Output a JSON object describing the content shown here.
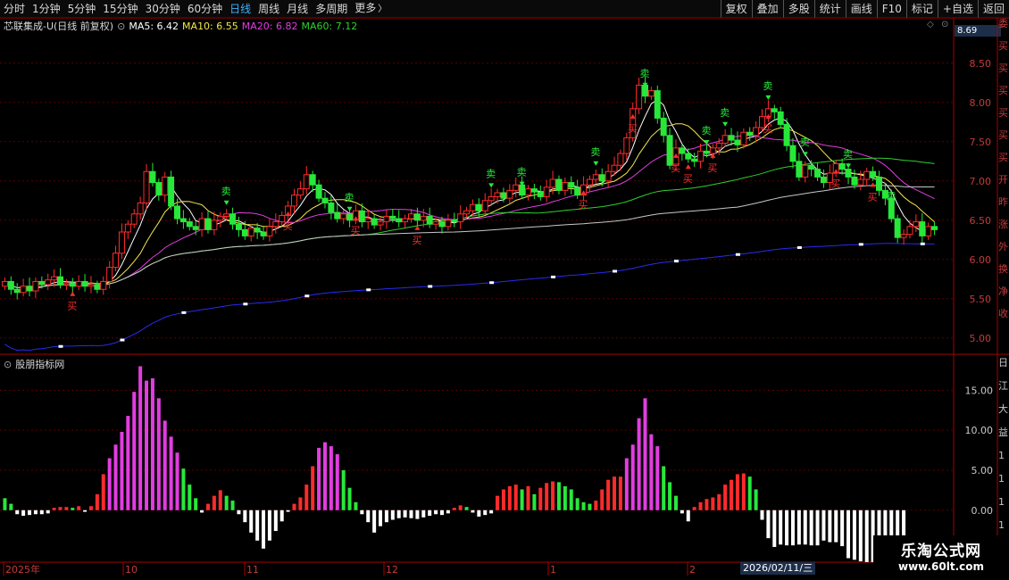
{
  "toolbar": {
    "tabs": [
      "分时",
      "1分钟",
      "5分钟",
      "15分钟",
      "30分钟",
      "60分钟",
      "日线",
      "周线",
      "月线",
      "多周期",
      "更多"
    ],
    "active_tab": "日线",
    "more_arrow": "〉",
    "buttons": [
      "复权",
      "叠加",
      "多股",
      "统计",
      "画线",
      "F10",
      "标记",
      "+自选",
      "返回"
    ]
  },
  "chart_header": {
    "title": "芯联集成-U(日线 前复权)",
    "ma5": "MA5: 6.42",
    "ma10": "MA10: 6.55",
    "ma20": "MA20: 6.82",
    "ma60": "MA60: 7.12",
    "current_price": "8.69"
  },
  "indicator_header": {
    "title": "股朋指标网"
  },
  "colors": {
    "up": "#ff2b2b",
    "down": "#27e83a",
    "ma5": "#ffffff",
    "ma10": "#f2e64a",
    "ma20": "#e23de0",
    "ma60": "#2ed12e",
    "ma_long1": "#c8c8c8",
    "ma_long2": "#2a2af0",
    "hist_magenta": "#e23de0",
    "hist_green": "#27e83a",
    "hist_red": "#ff2b2b",
    "hist_white": "#ffffff",
    "grid": "#5a0000"
  },
  "x_labels": [
    "2025年",
    "10",
    "11",
    "12",
    "1",
    "2"
  ],
  "cursor_date": "2026/02/11/三",
  "watermark": {
    "line1": "乐淘公式网",
    "line2": "www.60lt.com"
  },
  "signal_labels": {
    "buy": "买",
    "sell": "卖"
  },
  "right_strip_top": [
    "委",
    "买",
    "买",
    "买",
    "买",
    "买",
    "买",
    "开",
    "昨",
    "涨",
    "外",
    "换",
    "净",
    "收"
  ],
  "right_strip_bottom": [
    "日",
    "江",
    "大",
    "益",
    "1",
    "1",
    "1",
    "1"
  ],
  "chart_data": {
    "type": "candlestick",
    "title": "芯联集成-U(日线 前复权)",
    "price_axis": {
      "ticks": [
        5.0,
        5.5,
        6.0,
        6.5,
        7.0,
        7.5,
        8.0,
        8.5
      ],
      "range": [
        4.85,
        8.85
      ]
    },
    "indicator_axis": {
      "ticks": [
        0.0,
        5.0,
        10.0,
        15.0
      ],
      "range": [
        -6.5,
        18.5
      ]
    },
    "close": [
      5.72,
      5.62,
      5.58,
      5.66,
      5.6,
      5.72,
      5.68,
      5.74,
      5.78,
      5.68,
      5.7,
      5.66,
      5.72,
      5.66,
      5.68,
      5.62,
      5.72,
      5.9,
      6.08,
      6.35,
      6.45,
      6.58,
      6.72,
      7.12,
      6.98,
      6.82,
      7.05,
      6.68,
      6.52,
      6.48,
      6.42,
      6.38,
      6.52,
      6.38,
      6.5,
      6.55,
      6.58,
      6.45,
      6.38,
      6.3,
      6.4,
      6.35,
      6.3,
      6.42,
      6.48,
      6.56,
      6.68,
      6.82,
      6.9,
      7.08,
      6.95,
      6.78,
      6.72,
      6.6,
      6.52,
      6.58,
      6.5,
      6.62,
      6.48,
      6.52,
      6.44,
      6.48,
      6.55,
      6.52,
      6.48,
      6.52,
      6.58,
      6.5,
      6.55,
      6.45,
      6.48,
      6.42,
      6.5,
      6.48,
      6.58,
      6.62,
      6.7,
      6.62,
      6.75,
      6.8,
      6.85,
      6.78,
      6.88,
      6.95,
      6.82,
      6.9,
      6.86,
      6.8,
      6.92,
      7.02,
      6.88,
      6.98,
      6.92,
      6.82,
      6.95,
      7.02,
      7.08,
      7.0,
      7.12,
      7.2,
      7.35,
      7.55,
      7.92,
      8.22,
      8.08,
      8.15,
      7.8,
      7.58,
      7.2,
      7.42,
      7.35,
      7.28,
      7.25,
      7.38,
      7.35,
      7.42,
      7.48,
      7.58,
      7.52,
      7.46,
      7.62,
      7.58,
      7.68,
      7.82,
      7.92,
      7.88,
      7.72,
      7.45,
      7.25,
      7.05,
      7.2,
      7.15,
      7.05,
      6.98,
      7.1,
      7.22,
      7.15,
      7.05,
      6.95,
      7.02,
      7.12,
      7.05,
      6.88,
      6.78,
      6.52,
      6.28,
      6.32,
      6.42,
      6.48,
      6.3,
      6.42,
      6.38
    ],
    "ma_lines": {
      "MA5": 6.42,
      "MA10": 6.55,
      "MA20": 6.82,
      "MA60": 7.12
    },
    "indicator_values": [
      1.5,
      0.8,
      -0.5,
      -0.7,
      -0.6,
      -0.5,
      -0.5,
      -0.4,
      0.3,
      0.4,
      0.4,
      0.3,
      0.5,
      -0.2,
      0.5,
      2.0,
      4.5,
      6.5,
      8.2,
      9.8,
      11.8,
      14.8,
      18.0,
      16.2,
      16.5,
      14.0,
      11.2,
      9.2,
      7.2,
      5.2,
      3.2,
      1.5,
      -0.3,
      0.8,
      1.8,
      2.5,
      1.8,
      1.2,
      -0.5,
      -1.5,
      -2.8,
      -3.8,
      -4.8,
      -3.8,
      -2.6,
      -1.4,
      -0.2,
      0.8,
      1.6,
      3.2,
      5.5,
      7.8,
      8.5,
      8.0,
      7.0,
      5.0,
      2.8,
      1.0,
      -0.5,
      -1.5,
      -2.8,
      -2.0,
      -1.5,
      -1.2,
      -1.0,
      -0.9,
      -1.0,
      -1.1,
      -0.9,
      -0.7,
      -0.5,
      -0.6,
      -0.4,
      0.3,
      0.6,
      0.4,
      -0.3,
      -0.8,
      -0.6,
      -0.4,
      1.8,
      2.6,
      3.0,
      3.2,
      2.6,
      3.0,
      2.0,
      2.8,
      3.4,
      3.6,
      3.5,
      3.0,
      2.6,
      1.5,
      1.0,
      0.8,
      1.2,
      2.6,
      3.8,
      4.2,
      4.2,
      6.5,
      8.2,
      11.5,
      14.0,
      9.5,
      8.0,
      5.5,
      3.5,
      1.8,
      -0.4,
      -1.4,
      0.4,
      1.0,
      1.4,
      1.6,
      2.0,
      3.2,
      3.8,
      4.5,
      4.6,
      4.2,
      2.6,
      -1.2,
      -3.5,
      -4.6,
      -4.3,
      -4.4,
      -4.4,
      -4.3,
      -4.3,
      -4.4,
      -4.4,
      -3.8,
      -4.0,
      -4.0,
      -4.5,
      -6.0,
      -6.2,
      -6.4,
      -6.5,
      -6.5,
      -6.5,
      -6.5,
      -6.5,
      -6.5,
      -6.5
    ]
  }
}
